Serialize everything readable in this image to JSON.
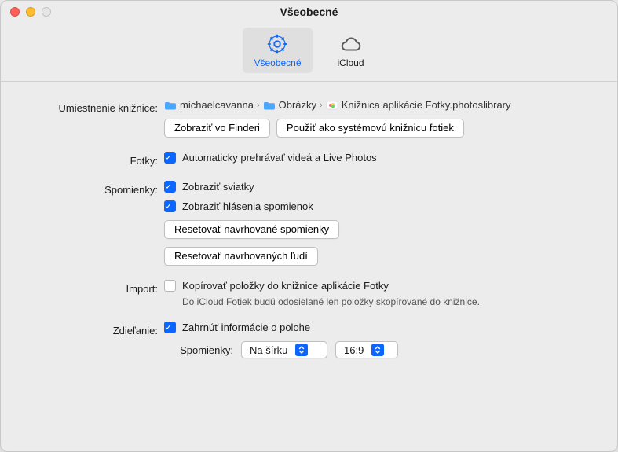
{
  "window": {
    "title": "Všeobecné"
  },
  "tabs": {
    "general": "Všeobecné",
    "icloud": "iCloud"
  },
  "library": {
    "label": "Umiestnenie knižnice:",
    "crumb1": "michaelcavanna",
    "crumb2": "Obrázky",
    "crumb3": "Knižnica aplikácie Fotky.photoslibrary",
    "btn_showfinder": "Zobraziť vo Finderi",
    "btn_usesystem": "Použiť ako systémovú knižnicu fotiek"
  },
  "photos": {
    "label": "Fotky:",
    "autoplay": "Automaticky prehrávať videá a Live Photos"
  },
  "memories": {
    "label": "Spomienky:",
    "holidays": "Zobraziť sviatky",
    "notifs": "Zobraziť hlásenia spomienok",
    "btn_reset_mem": "Resetovať navrhované spomienky",
    "btn_reset_people": "Resetovať navrhovaných ľudí"
  },
  "import": {
    "label": "Import:",
    "copy": "Kopírovať položky do knižnice aplikácie Fotky",
    "hint": "Do iCloud Fotiek budú odosielané len položky skopírované do knižnice."
  },
  "sharing": {
    "label": "Zdieľanie:",
    "location": "Zahrnúť informácie o polohe",
    "memories_label": "Spomienky:",
    "orientation": "Na šírku",
    "aspect": "16:9"
  }
}
